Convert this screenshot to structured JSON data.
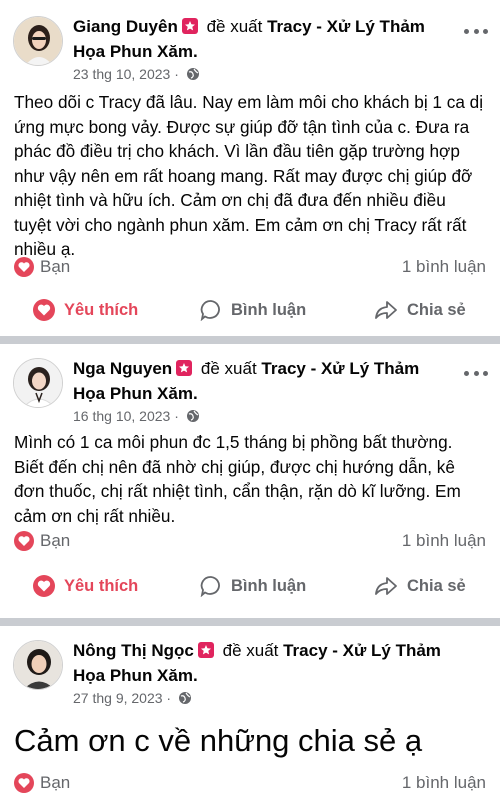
{
  "posts": [
    {
      "author": "Giang Duyên",
      "verb": "đề xuất",
      "page_name": "Tracy - Xử Lý Thảm Họa Phun Xăm.",
      "date": "23 thg 10, 2023",
      "body": "Theo dõi c Tracy đã lâu. Nay em làm môi cho khách bị 1 ca dị ứng mực bong vảy. Được sự giúp đỡ tận tình của c. Đưa ra phác đồ điều trị cho khách. Vì lần đầu tiên gặp trường hợp như vậy nên em rất hoang mang. Rất may được chị giúp đỡ nhiệt tình và hữu ích. Cảm ơn chị đã đưa đến nhiều điều tuyệt vời cho ngành phun xăm. Em cảm ơn chị Tracy rất rất nhiều ạ.",
      "reaction_label": "Bạn",
      "comments": "1 bình luận",
      "actions": {
        "like": "Yêu thích",
        "comment": "Bình luận",
        "share": "Chia sẻ"
      }
    },
    {
      "author": "Nga Nguyen",
      "verb": "đề xuất",
      "page_name": "Tracy - Xử Lý Thảm Họa Phun Xăm.",
      "date": "16 thg 10, 2023",
      "body": "Mình có 1 ca môi phun đc 1,5 tháng bị phồng bất thường. Biết đến chị nên đã nhờ chị giúp, được chị hướng dẫn, kê đơn thuốc, chị rất nhiệt tình, cẩn thận, rặn dò kĩ lưỡng. Em cảm ơn chị rất nhiều.",
      "reaction_label": "Bạn",
      "comments": "1 bình luận",
      "actions": {
        "like": "Yêu thích",
        "comment": "Bình luận",
        "share": "Chia sẻ"
      }
    },
    {
      "author": "Nông Thị Ngọc",
      "verb": "đề xuất",
      "page_name": "Tracy - Xử Lý Thảm Họa Phun Xăm.",
      "date": "27 thg 9, 2023",
      "body": "Cảm ơn c về những chia sẻ ạ",
      "reaction_label": "Bạn",
      "comments": "1 bình luận"
    }
  ],
  "colors": {
    "love": "#e4465a",
    "badge": "#e0245e",
    "muted": "#65676b",
    "separator": "#c9ccd1"
  }
}
